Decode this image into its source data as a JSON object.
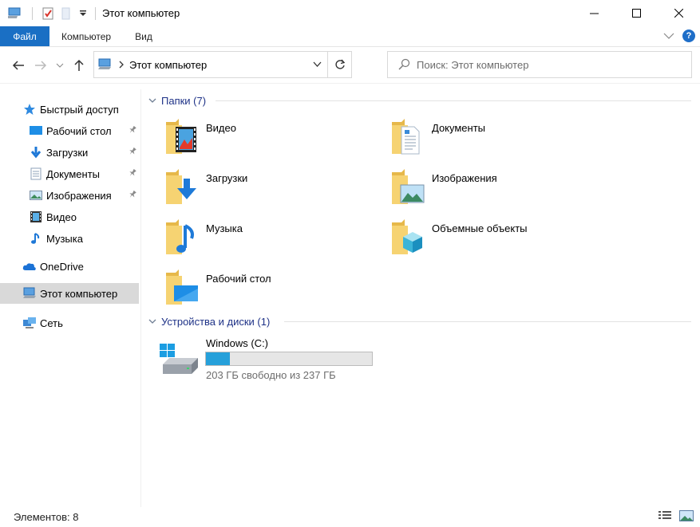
{
  "window": {
    "title": "Этот компьютер"
  },
  "ribbon": {
    "tabs": [
      "Файл",
      "Компьютер",
      "Вид"
    ]
  },
  "address": {
    "path": "Этот компьютер",
    "search_placeholder": "Поиск: Этот компьютер"
  },
  "sidebar": {
    "quick_access": "Быстрый доступ",
    "items": [
      {
        "label": "Рабочий стол",
        "icon": "desktop-icon",
        "pinned": true
      },
      {
        "label": "Загрузки",
        "icon": "downloads-icon",
        "pinned": true
      },
      {
        "label": "Документы",
        "icon": "documents-icon",
        "pinned": true
      },
      {
        "label": "Изображения",
        "icon": "pictures-icon",
        "pinned": true
      },
      {
        "label": "Видео",
        "icon": "video-icon",
        "pinned": false
      },
      {
        "label": "Музыка",
        "icon": "music-icon",
        "pinned": false
      }
    ],
    "onedrive": "OneDrive",
    "this_pc": "Этот компьютер",
    "network": "Сеть"
  },
  "content": {
    "folders_header": "Папки (7)",
    "folders": [
      {
        "label": "Видео",
        "icon": "video-folder-icon"
      },
      {
        "label": "Документы",
        "icon": "documents-folder-icon"
      },
      {
        "label": "Загрузки",
        "icon": "downloads-folder-icon"
      },
      {
        "label": "Изображения",
        "icon": "pictures-folder-icon"
      },
      {
        "label": "Музыка",
        "icon": "music-folder-icon"
      },
      {
        "label": "Объемные объекты",
        "icon": "3d-objects-folder-icon"
      },
      {
        "label": "Рабочий стол",
        "icon": "desktop-folder-icon"
      }
    ],
    "devices_header": "Устройства и диски (1)",
    "drive": {
      "name": "Windows (C:)",
      "free_text": "203 ГБ свободно из 237 ГБ",
      "used_fraction": 0.143
    }
  },
  "status": {
    "count": "Элементов: 8"
  },
  "colors": {
    "accent": "#1a6fc4",
    "group_header": "#1e3287",
    "selected": "#d9d9d9",
    "drive_bar": "#26a0da"
  }
}
